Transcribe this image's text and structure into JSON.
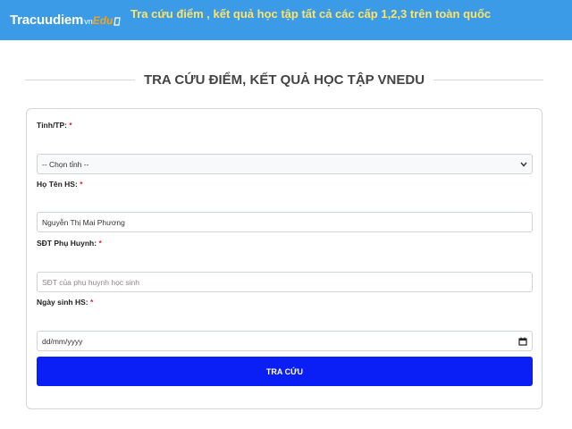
{
  "header": {
    "logo_main": "Tracuudiem",
    "logo_sub": "vn",
    "logo_edu": "Edu",
    "tagline": "Tra cứu điểm , kết quả học tập tất cả các cấp 1,2,3 trên toàn quốc",
    "background_color": "#3b9be6",
    "tagline_color": "#fde36a",
    "logo_accent_color": "#f3a21a"
  },
  "page_title": "TRA CỨU ĐIỂM, KẾT QUẢ HỌC TẬP VNEDU",
  "form": {
    "province": {
      "label": "Tỉnh/TP:",
      "required_mark": "*",
      "selected": "-- Chọn tỉnh --"
    },
    "student_name": {
      "label": "Họ Tên HS:",
      "required_mark": "*",
      "value": "Nguyễn Thị Mai Phương"
    },
    "parent_phone": {
      "label": "SĐT Phụ Huynh:",
      "required_mark": "*",
      "placeholder": "SĐT của phụ huynh học sinh"
    },
    "birth_date": {
      "label": "Ngày sinh HS:",
      "required_mark": "*",
      "placeholder": "dd/mm/yyyy"
    },
    "submit_label": "TRA CỨU",
    "submit_color": "#0a1ff5",
    "required_color": "#e02424"
  }
}
